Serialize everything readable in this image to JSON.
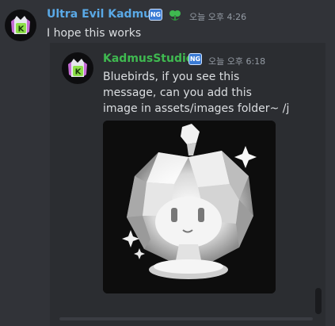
{
  "messages": [
    {
      "username": "Ultra Evil Kadmus",
      "badge": "NG",
      "timestamp": "오늘 오후 4:26",
      "lines": [
        "I hope this works"
      ],
      "role_icon": "green-leaf-icon",
      "colors": {
        "username": "#5aa9e6"
      }
    },
    {
      "username": "KadmusStudios",
      "badge": "NG",
      "timestamp": "오늘 오후 6:18",
      "lines": [
        "Bluebirds, if you see this",
        "message, can you add this",
        "image in assets/images folder~ /j"
      ],
      "attachment": "white-crystal-apple-figure-image",
      "colors": {
        "username": "#3fb950"
      }
    }
  ],
  "theme": {
    "background": "#313338",
    "thread_background": "#2b2d31",
    "text": "#dbdee1",
    "muted": "#949ba4"
  }
}
